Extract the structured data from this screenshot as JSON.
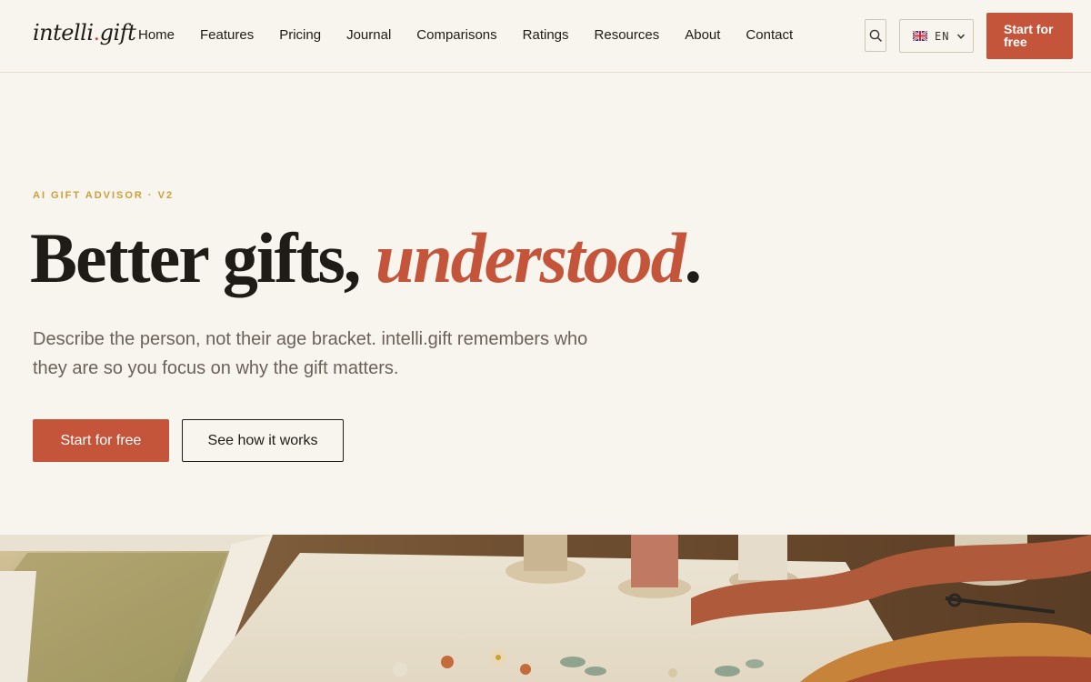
{
  "brand": {
    "logo_part1": "intelli",
    "logo_dot": ".",
    "logo_part2": "gift"
  },
  "nav": {
    "items": [
      {
        "label": "Home"
      },
      {
        "label": "Features"
      },
      {
        "label": "Pricing"
      },
      {
        "label": "Journal"
      },
      {
        "label": "Comparisons"
      },
      {
        "label": "Ratings"
      },
      {
        "label": "Resources"
      },
      {
        "label": "About"
      },
      {
        "label": "Contact"
      }
    ]
  },
  "header": {
    "search_icon": "search-icon",
    "language": {
      "flag": "uk-flag-icon",
      "code": "EN"
    },
    "cta_label": "Start for free"
  },
  "hero": {
    "eyebrow": "AI GIFT ADVISOR · V2",
    "headline_plain": "Better gifts, ",
    "headline_accent": "understood",
    "headline_end": ".",
    "subcopy": "Describe the person, not their age bracket. intelli.gift remembers who they are so you focus on why the gift matters.",
    "primary_cta": "Start for free",
    "secondary_cta": "See how it works"
  },
  "colors": {
    "background": "#f8f4ee",
    "accent": "#c4553a",
    "eyebrow": "#c9a03a",
    "text": "#1f1b17",
    "muted_text": "#6b625a"
  }
}
